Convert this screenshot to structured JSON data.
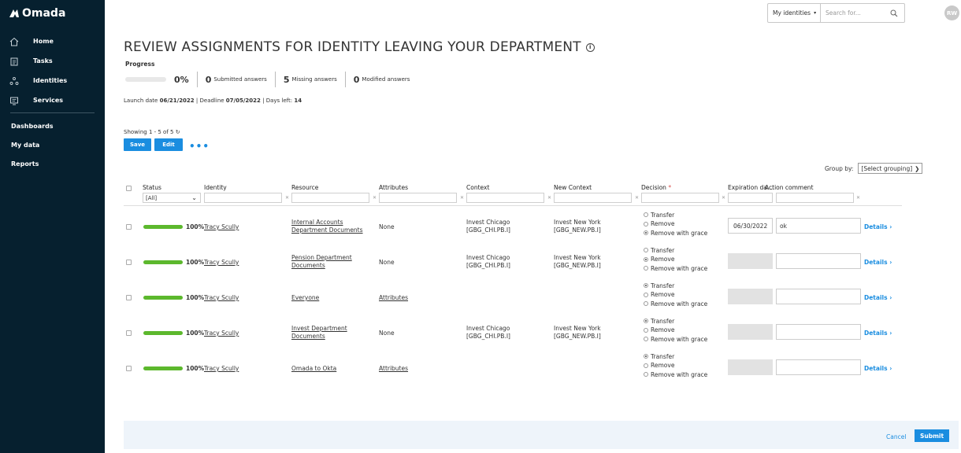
{
  "app": {
    "logo_text": "Omada",
    "user_initials": "RW"
  },
  "sidebar": {
    "items": [
      {
        "label": "Home",
        "icon": "home-icon"
      },
      {
        "label": "Tasks",
        "icon": "tasks-icon"
      },
      {
        "label": "Identities",
        "icon": "identities-icon"
      },
      {
        "label": "Services",
        "icon": "services-icon"
      }
    ],
    "links": [
      "Dashboards",
      "My data",
      "Reports"
    ]
  },
  "header": {
    "identity_select": "My identities",
    "search_placeholder": "Search for..."
  },
  "page": {
    "title": "REVIEW ASSIGNMENTS FOR IDENTITY LEAVING YOUR DEPARTMENT",
    "info_icon": "info-icon",
    "progress_label": "Progress",
    "progress_percent": "0%",
    "progress_fraction": 0.0,
    "submitted_count": "0",
    "submitted_label": "Submitted answers",
    "missing_count": "5",
    "missing_label": "Missing answers",
    "modified_count": "0",
    "modified_label": "Modified answers",
    "launch_label": "Launch date",
    "launch_date": "06/21/2022",
    "deadline_label": "Deadline",
    "deadline_date": "07/05/2022",
    "days_left_label": "Days left:",
    "days_left": "14",
    "showing": "Showing 1 - 5 of 5",
    "save_label": "Save",
    "edit_label": "Edit",
    "more_label": "•••",
    "group_by_label": "Group by:",
    "group_by_value": "[Select grouping]"
  },
  "table": {
    "headers": {
      "status": "Status",
      "identity": "Identity",
      "resource": "Resource",
      "attributes": "Attributes",
      "context": "Context",
      "new_context": "New Context",
      "decision": "Decision",
      "decision_required": "*",
      "expiration": "Expiration da...",
      "comment": "Action comment"
    },
    "status_filter": "[All]",
    "radio_labels": [
      "Transfer",
      "Remove",
      "Remove with grace"
    ],
    "details_label": "Details",
    "rows": [
      {
        "percent": "100%",
        "progress_fraction": 1.0,
        "identity": "Tracy Scully",
        "resource_line1": "Internal Accounts",
        "resource_line2": "Department Documents",
        "attributes": "None",
        "attributes_link": false,
        "context_line1": "Invest Chicago",
        "context_line2": "[GBG_CHI.PB.I]",
        "new_context_line1": "Invest New York",
        "new_context_line2": "[GBG_NEW.PB.I]",
        "decision": 2,
        "expiration": "06/30/2022",
        "comment": "ok"
      },
      {
        "percent": "100%",
        "progress_fraction": 1.0,
        "identity": "Tracy Scully",
        "resource_line1": "Pension Department",
        "resource_line2": "Documents",
        "attributes": "None",
        "attributes_link": false,
        "context_line1": "Invest Chicago",
        "context_line2": "[GBG_CHI.PB.I]",
        "new_context_line1": "Invest New York",
        "new_context_line2": "[GBG_NEW.PB.I]",
        "decision": 1,
        "expiration": "",
        "comment": ""
      },
      {
        "percent": "100%",
        "progress_fraction": 1.0,
        "identity": "Tracy Scully",
        "resource_line1": "Everyone",
        "resource_line2": "",
        "attributes": "Attributes",
        "attributes_link": true,
        "context_line1": "",
        "context_line2": "",
        "new_context_line1": "",
        "new_context_line2": "",
        "decision": 0,
        "expiration": "",
        "comment": ""
      },
      {
        "percent": "100%",
        "progress_fraction": 1.0,
        "identity": "Tracy Scully",
        "resource_line1": "Invest Department",
        "resource_line2": "Documents",
        "attributes": "None",
        "attributes_link": false,
        "context_line1": "Invest Chicago",
        "context_line2": "[GBG_CHI.PB.I]",
        "new_context_line1": "Invest New York",
        "new_context_line2": "[GBG_NEW.PB.I]",
        "decision": 0,
        "expiration": "",
        "comment": ""
      },
      {
        "percent": "100%",
        "progress_fraction": 1.0,
        "identity": "Tracy Scully",
        "resource_line1": "Omada to Okta",
        "resource_line2": "",
        "attributes": "Attributes",
        "attributes_link": true,
        "context_line1": "",
        "context_line2": "",
        "new_context_line1": "",
        "new_context_line2": "",
        "decision": 0,
        "expiration": "",
        "comment": ""
      }
    ]
  },
  "footer": {
    "cancel_label": "Cancel",
    "submit_label": "Submit"
  },
  "colors": {
    "sidebar_bg": "#06202f",
    "accent": "#1a8de0",
    "progress_green": "#5cb82d",
    "footer_bg": "#eef4fa"
  }
}
